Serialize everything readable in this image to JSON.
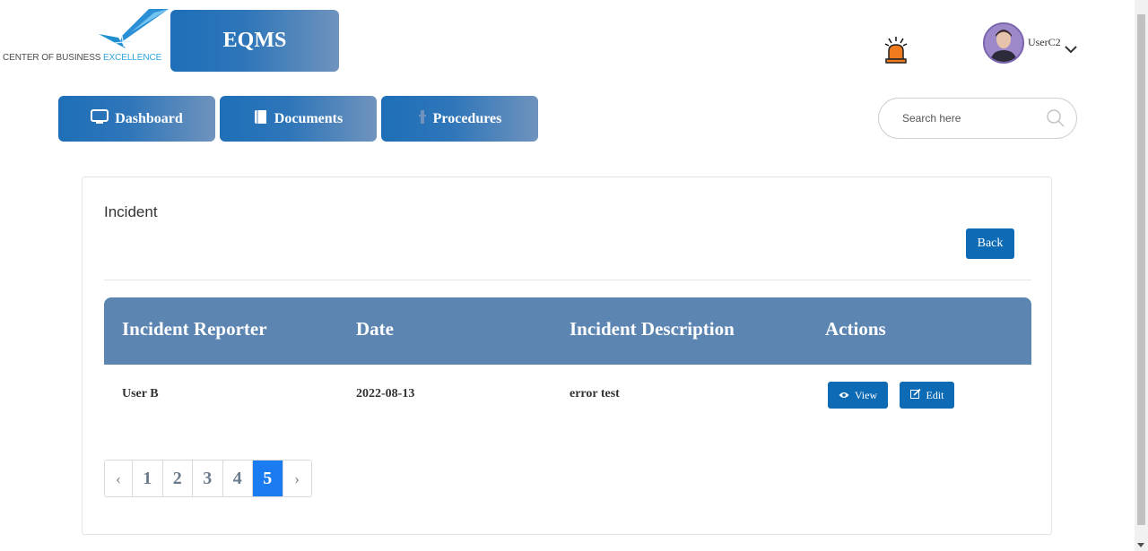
{
  "header": {
    "logo_text_main": "CENTER OF BUSINESS ",
    "logo_text_accent": "EXCELLENCE",
    "app_name": "EQMS",
    "alarm_icon": "alarm-siren-icon",
    "username": "UserC2"
  },
  "nav": {
    "dashboard": "Dashboard",
    "documents": "Documents",
    "procedures": "Procedures"
  },
  "search": {
    "placeholder": "Search here"
  },
  "page": {
    "title": "Incident",
    "back_label": "Back"
  },
  "table": {
    "columns": [
      "Incident Reporter",
      "Date",
      "Incident Description",
      "Actions"
    ],
    "rows": [
      {
        "reporter": "User B",
        "date": "2022-08-13",
        "description": "error test",
        "view_label": "View",
        "edit_label": "Edit"
      }
    ]
  },
  "pagination": {
    "prev": "‹",
    "pages": [
      "1",
      "2",
      "3",
      "4",
      "5"
    ],
    "current": "5",
    "next": "›"
  },
  "colors": {
    "primary": "#0d6ab4",
    "table_header": "#5c85b2",
    "active_page": "#1a7cf0"
  }
}
